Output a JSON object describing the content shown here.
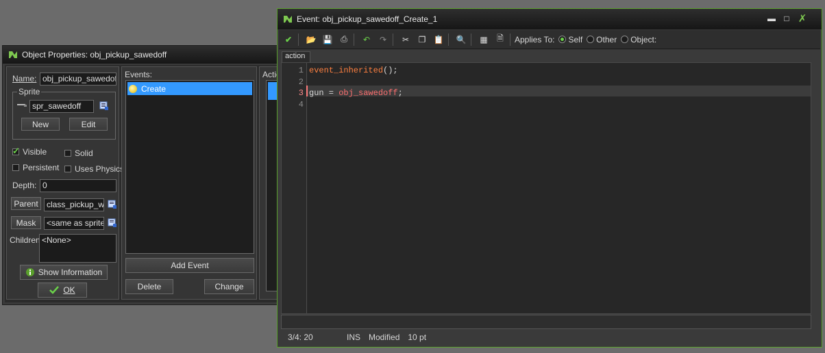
{
  "object_window": {
    "title": "Object Properties: obj_pickup_sawedoff",
    "name_label": "Name:",
    "name_value": "obj_pickup_sawedoff",
    "sprite_group_label": "Sprite",
    "sprite_value": "spr_sawedoff",
    "new_label": "New",
    "edit_label": "Edit",
    "visible_label": "Visible",
    "solid_label": "Solid",
    "persistent_label": "Persistent",
    "uses_physics_label": "Uses Physics",
    "depth_label": "Depth:",
    "depth_value": "0",
    "parent_label": "Parent",
    "parent_value": "class_pickup_wea",
    "mask_label": "Mask",
    "mask_value": "<same as sprite>",
    "children_label": "Children:",
    "children_value": "<None>",
    "show_info_label": "Show Information",
    "ok_label": "OK",
    "events_label": "Events:",
    "events": [
      "Create"
    ],
    "add_event_label": "Add Event",
    "delete_label": "Delete",
    "change_label": "Change",
    "actions_label": "Actio"
  },
  "event_window": {
    "title": "Event: obj_pickup_sawedoff_Create_1",
    "applies_to_label": "Applies To:",
    "self_label": "Self",
    "other_label": "Other",
    "object_label": "Object:",
    "tab_label": "action",
    "line_numbers": [
      "1",
      "2",
      "3",
      "4"
    ],
    "code": {
      "line1_fn": "event_inherited",
      "line1_rest": "();",
      "line3_var": "gun = ",
      "line3_obj": "obj_sawedoff",
      "line3_end": ";"
    },
    "status": {
      "position": "3/4:  20",
      "mode": "INS",
      "modified": "Modified",
      "font_size": "10 pt"
    }
  },
  "colors": {
    "accent_green": "#5aa02c",
    "selection_blue": "#3399ff",
    "function_orange": "#ff8040",
    "object_red": "#ff7070"
  }
}
